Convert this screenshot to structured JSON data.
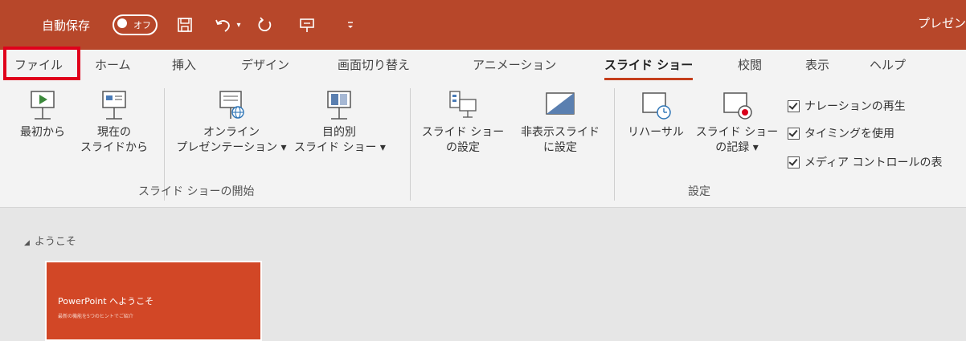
{
  "titlebar": {
    "autosave_label": "自動保存",
    "autosave_state": "オフ",
    "doc_title": "プレゼン",
    "icons": [
      "save-icon",
      "undo-icon",
      "redo-icon",
      "presentation-icon",
      "customize-icon"
    ],
    "accent_color": "#b7472a"
  },
  "tabs": {
    "file": "ファイル",
    "home": "ホーム",
    "insert": "挿入",
    "design": "デザイン",
    "transitions": "画面切り替え",
    "animations": "アニメーション",
    "slideshow": "スライド ショー",
    "review": "校閲",
    "view": "表示",
    "help": "ヘルプ",
    "active": "スライド ショー"
  },
  "ribbon": {
    "start": {
      "from_beginning": "最初から",
      "from_current_1": "現在の",
      "from_current_2": "スライドから",
      "online_1": "オンライン",
      "online_2": "プレゼンテーション ▾",
      "custom_1": "目的別",
      "custom_2": "スライド ショー ▾",
      "group_label": "スライド ショーの開始"
    },
    "setup": {
      "setup_show_1": "スライド ショー",
      "setup_show_2": "の設定",
      "hide_slide_1": "非表示スライド",
      "hide_slide_2": "に設定",
      "rehearse": "リハーサル",
      "record_1": "スライド ショー",
      "record_2": "の記録 ▾",
      "group_label": "設定",
      "checks": [
        "ナレーションの再生",
        "タイミングを使用",
        "メディア コントロールの表"
      ]
    }
  },
  "slides": {
    "section": "ようこそ",
    "thumb_title": "PowerPoint へようこそ",
    "thumb_subtitle": "最新の機能を5つのヒントでご紹介"
  }
}
